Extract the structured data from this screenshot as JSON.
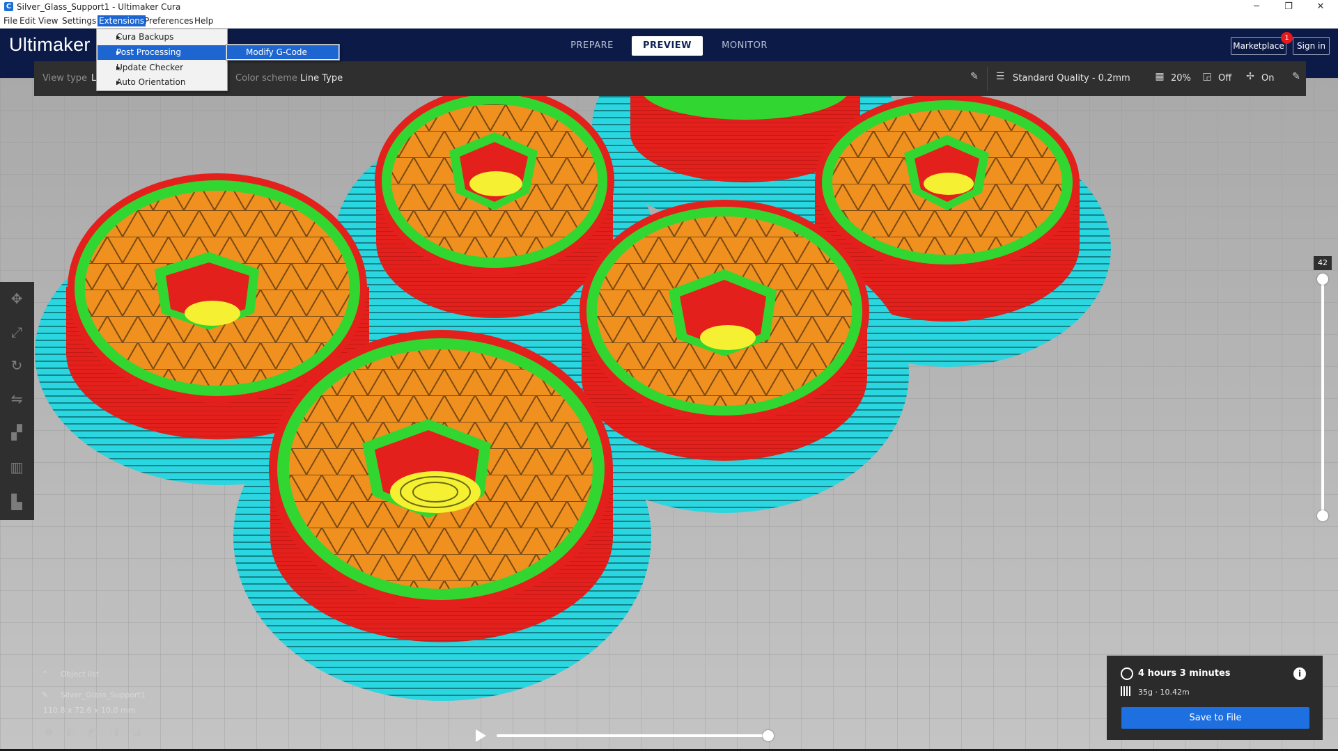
{
  "window": {
    "title": "Silver_Glass_Support1 - Ultimaker Cura",
    "minimize": "─",
    "restore": "❐",
    "close": "✕"
  },
  "menubar": {
    "items": [
      "File",
      "Edit",
      "View",
      "Settings",
      "Extensions",
      "Preferences",
      "Help"
    ],
    "active": "Extensions"
  },
  "extensions_menu": {
    "items": [
      {
        "label": "Cura Backups",
        "has_submenu": true
      },
      {
        "label": "Post Processing",
        "has_submenu": true,
        "highlighted": true
      },
      {
        "label": "Update Checker",
        "has_submenu": true
      },
      {
        "label": "Auto Orientation",
        "has_submenu": true
      }
    ],
    "submenu": {
      "items": [
        "Modify G-Code"
      ]
    }
  },
  "header": {
    "logo": "Ultimaker",
    "tabs": [
      "PREPARE",
      "PREVIEW",
      "MONITOR"
    ],
    "selected_tab": "PREVIEW",
    "marketplace": "Marketplace",
    "marketplace_badge": "1",
    "sign_in": "Sign in"
  },
  "view_bar": {
    "view_type_label": "View type",
    "view_type_value": "L",
    "color_scheme_label": "Color scheme",
    "color_scheme_value": "Line Type",
    "quality": "Standard Quality - 0.2mm",
    "infill": "20%",
    "support": "Off",
    "adhesion": "On"
  },
  "layer_slider": {
    "current_layer": "42"
  },
  "object_list": {
    "header": "Object list",
    "object_name": "Silver_Glass_Support1",
    "dimensions": "110.8 x 72.6 x 10.0 mm"
  },
  "print_info": {
    "time": "4 hours 3 minutes",
    "material": "35g · 10.42m",
    "save_button": "Save to File"
  },
  "line_type_colors": {
    "wall_outer": "#e3201b",
    "wall_inner": "#32d630",
    "infill": "#f0901e",
    "skin": "#f5f032",
    "skirt_brim": "#2ad6e0"
  },
  "icons": {
    "pencil": "pencil-icon",
    "quality": "quality-icon",
    "infill": "infill-icon",
    "support": "support-icon",
    "adhesion": "adhesion-icon",
    "clock": "clock-icon",
    "info": "info-icon",
    "spool": "spool-icon",
    "play": "play-icon",
    "tools": [
      "move-icon",
      "scale-icon",
      "rotate-icon",
      "mirror-icon",
      "per-model-settings-icon",
      "support-blocker-icon",
      "layflat-icon"
    ]
  }
}
